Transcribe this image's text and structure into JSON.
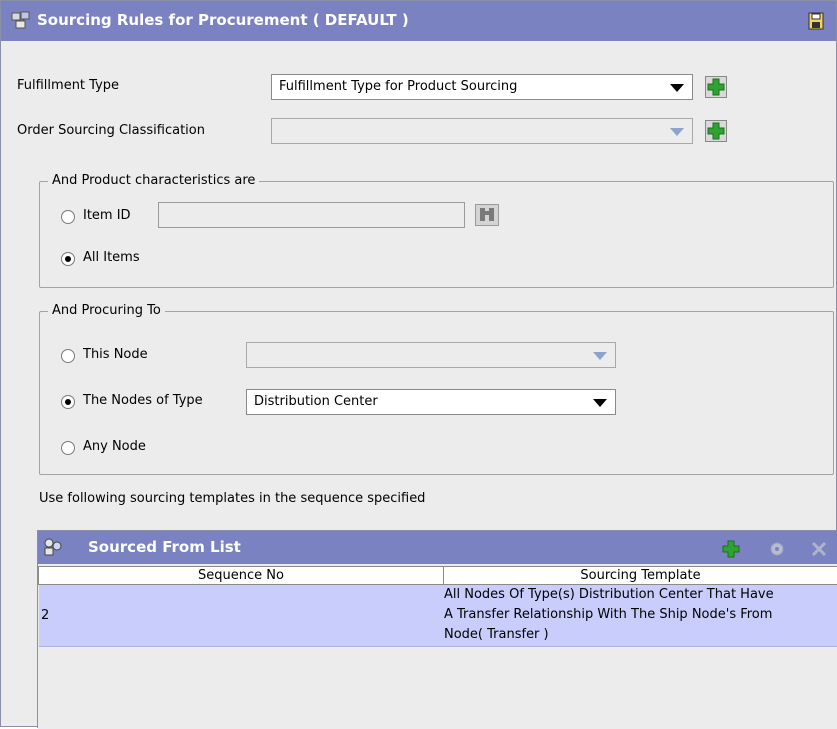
{
  "window": {
    "title": "Sourcing Rules for Procurement ( DEFAULT )",
    "title_icon": "sourcing-rules-icon",
    "save_icon": "save-icon"
  },
  "form": {
    "fulfillment_type": {
      "label": "Fulfillment Type",
      "value": "Fulfillment Type for Product Sourcing"
    },
    "order_sourcing_classification": {
      "label": "Order Sourcing Classification",
      "value": ""
    }
  },
  "product_group": {
    "legend": "And Product characteristics are",
    "item_id_label": "Item ID",
    "item_id_value": "",
    "all_items_label": "All Items",
    "selected": "All Items"
  },
  "procuring_group": {
    "legend": "And Procuring To",
    "this_node_label": "This Node",
    "this_node_value": "",
    "nodes_of_type_label": "The Nodes of Type",
    "nodes_of_type_value": "Distribution Center",
    "any_node_label": "Any Node",
    "selected": "The Nodes of Type"
  },
  "templates_caption": "Use following sourcing templates in the sequence specified",
  "sourced_from": {
    "title": "Sourced From List",
    "columns": [
      "Sequence No",
      "Sourcing Template"
    ],
    "rows": [
      {
        "sequence_no": "2",
        "template_lines": [
          "All Nodes Of Type(s) Distribution Center That Have",
          "A Transfer Relationship With The Ship Node's From",
          "Node( Transfer )"
        ]
      }
    ]
  },
  "colors": {
    "title_bar": "#7b82c1",
    "selected_row": "#c8cdfb",
    "add_green": "#2fa32f"
  }
}
